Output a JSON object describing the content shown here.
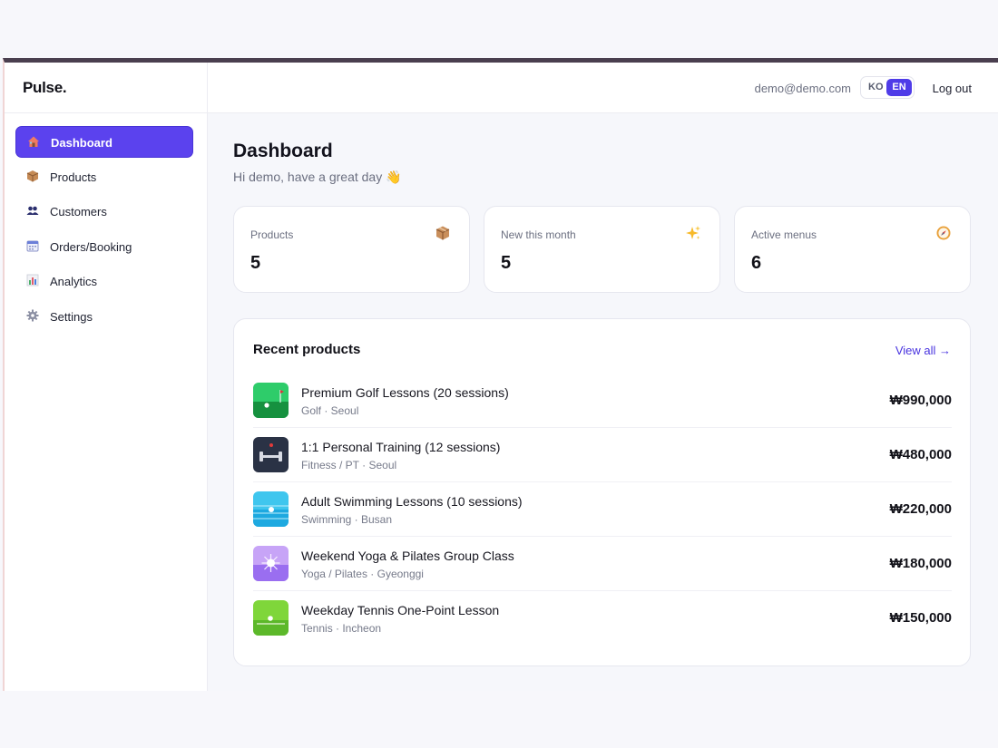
{
  "app": {
    "brand": "Pulse."
  },
  "header": {
    "email": "demo@demo.com",
    "lang_ko": "KO",
    "lang_en": "EN",
    "logout": "Log out"
  },
  "sidebar": {
    "items": [
      {
        "label": "Dashboard",
        "icon": "house-icon",
        "active": true
      },
      {
        "label": "Products",
        "icon": "box-icon",
        "active": false
      },
      {
        "label": "Customers",
        "icon": "users-icon",
        "active": false
      },
      {
        "label": "Orders/Booking",
        "icon": "calendar-icon",
        "active": false
      },
      {
        "label": "Analytics",
        "icon": "bar-chart-icon",
        "active": false
      },
      {
        "label": "Settings",
        "icon": "gear-icon",
        "active": false
      }
    ]
  },
  "main": {
    "title": "Dashboard",
    "greeting": "Hi demo, have a great day 👋",
    "stats": [
      {
        "label": "Products",
        "value": "5",
        "icon": "package-icon",
        "glyph": "📦"
      },
      {
        "label": "New this month",
        "value": "5",
        "icon": "sparkles-icon",
        "glyph": "✨"
      },
      {
        "label": "Active menus",
        "value": "6",
        "icon": "compass-icon",
        "glyph": "🧭"
      }
    ],
    "recent": {
      "title": "Recent products",
      "view_all": "View all →",
      "products": [
        {
          "name": "Premium Golf Lessons (20 sessions)",
          "meta": "Golf · Seoul",
          "price": "₩990,000",
          "thumb": "golf-thumbnail"
        },
        {
          "name": "1:1 Personal Training (12 sessions)",
          "meta": "Fitness / PT · Seoul",
          "price": "₩480,000",
          "thumb": "fitness-thumbnail"
        },
        {
          "name": "Adult Swimming Lessons (10 sessions)",
          "meta": "Swimming · Busan",
          "price": "₩220,000",
          "thumb": "swimming-thumbnail"
        },
        {
          "name": "Weekend Yoga & Pilates Group Class",
          "meta": "Yoga / Pilates · Gyeonggi",
          "price": "₩180,000",
          "thumb": "yoga-thumbnail"
        },
        {
          "name": "Weekday Tennis One-Point Lesson",
          "meta": "Tennis · Incheon",
          "price": "₩150,000",
          "thumb": "tennis-thumbnail"
        }
      ]
    }
  }
}
